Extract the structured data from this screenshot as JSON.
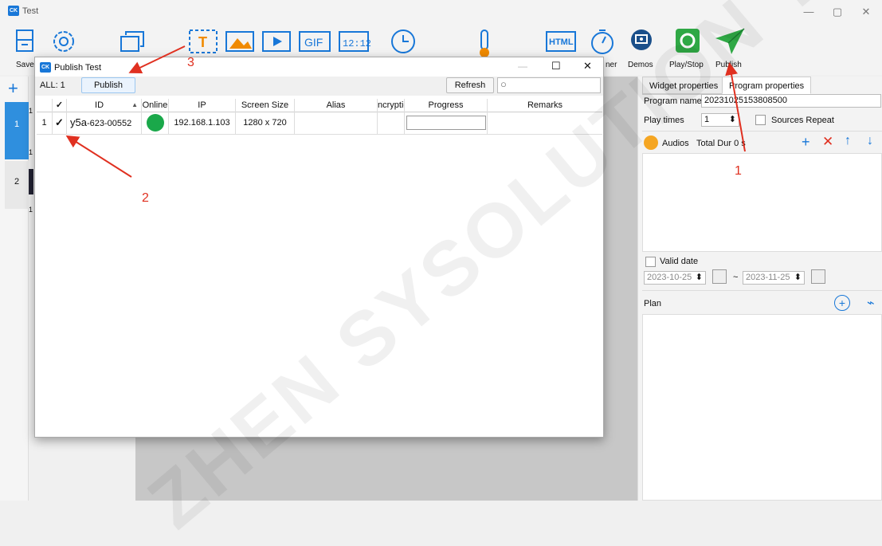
{
  "window": {
    "title": "Test",
    "minimize": "—",
    "restore": "▢",
    "close": "✕"
  },
  "toolbar": {
    "save_label": "Save",
    "demos_label": "Demos",
    "play_label": "Play/Stop",
    "publish_label": "Publish",
    "timer_partial": "ner",
    "gif_text": "GIF",
    "html_text": "HTML",
    "t_text": "T",
    "clock_text": "12:12"
  },
  "left_panel": {
    "add": "+",
    "items": [
      "1",
      "2"
    ],
    "sub_numbers": [
      "1",
      "1",
      "1"
    ]
  },
  "right_panel": {
    "tabs": [
      "Widget properties",
      "Program properties"
    ],
    "program_name_label": "Program name",
    "program_name_value": "20231025153808500",
    "play_times_label": "Play times",
    "play_times_value": "1",
    "sources_repeat_label": "Sources Repeat",
    "audios_label": "Audios",
    "total_dur": "Total Dur 0 s",
    "valid_date_label": "Valid date",
    "date_from": "2023-10-25",
    "date_to": "2023-11-25",
    "tilde": "~",
    "plan_label": "Plan"
  },
  "dialog": {
    "title": "Publish Test",
    "all_label": "ALL: 1",
    "publish_button": "Publish",
    "refresh_button": "Refresh",
    "search_placeholder": "",
    "columns": [
      "✓",
      "ID",
      "Online",
      "IP",
      "Screen Size",
      "Alias",
      "ncryptic",
      "Progress",
      "Remarks"
    ],
    "rows": [
      {
        "num": "1",
        "check": "✓",
        "id_main": "y5a",
        "id_rest": "-623-00552",
        "online": true,
        "ip": "192.168.1.103",
        "screen_size": "1280 x 720",
        "alias": "",
        "encryption": "",
        "progress": "",
        "remarks": ""
      }
    ],
    "sort_indicator": "▲"
  },
  "annotations": {
    "n1": "1",
    "n2": "2",
    "n3": "3"
  },
  "watermark": "ZHEN SYSOLUTION TEC",
  "colors": {
    "accent": "#1877d8",
    "online": "#1aa84a",
    "arrow": "#e03020",
    "publish_green": "#2fa845"
  }
}
